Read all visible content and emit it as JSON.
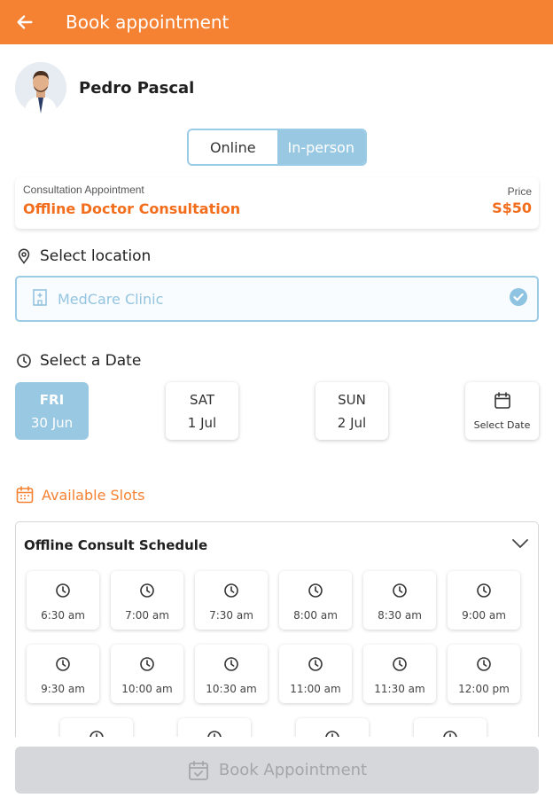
{
  "appbar": {
    "title": "Book appointment",
    "back_icon": "arrow-left-icon"
  },
  "doctor": {
    "name": "Pedro Pascal"
  },
  "mode_toggle": {
    "options": [
      "Online",
      "In-person"
    ],
    "selected": "In-person"
  },
  "consultation": {
    "subtitle": "Consultation Appointment",
    "type": "Offline Doctor Consultation",
    "price_label": "Price",
    "price": "S$50"
  },
  "location": {
    "heading": "Select location",
    "heading_icon": "map-pin-icon",
    "selected": "MedCare Clinic",
    "field_icon": "hospital-icon",
    "status_icon": "check-circle-icon"
  },
  "date": {
    "heading": "Select a Date",
    "heading_icon": "clock-icon",
    "options": [
      {
        "day": "FRI",
        "date": "30 Jun",
        "selected": true
      },
      {
        "day": "SAT",
        "date": "1 Jul",
        "selected": false
      },
      {
        "day": "SUN",
        "date": "2 Jul",
        "selected": false
      }
    ],
    "picker_label": "Select Date",
    "picker_icon": "calendar-icon"
  },
  "slots": {
    "heading": "Available Slots",
    "heading_icon": "calendar-icon",
    "schedule_title": "Offline Consult Schedule",
    "times": [
      "6:30 am",
      "7:00 am",
      "7:30 am",
      "8:00 am",
      "8:30 am",
      "9:00 am",
      "9:30 am",
      "10:00 am",
      "10:30 am",
      "11:00 am",
      "11:30 am",
      "12:00 pm",
      "",
      "",
      "",
      ""
    ]
  },
  "book_button": {
    "label": "Book Appointment",
    "icon": "calendar-check-icon"
  },
  "colors": {
    "primary": "#f58233",
    "accent_blue": "#99c8e2",
    "disabled": "#d5d7da"
  }
}
